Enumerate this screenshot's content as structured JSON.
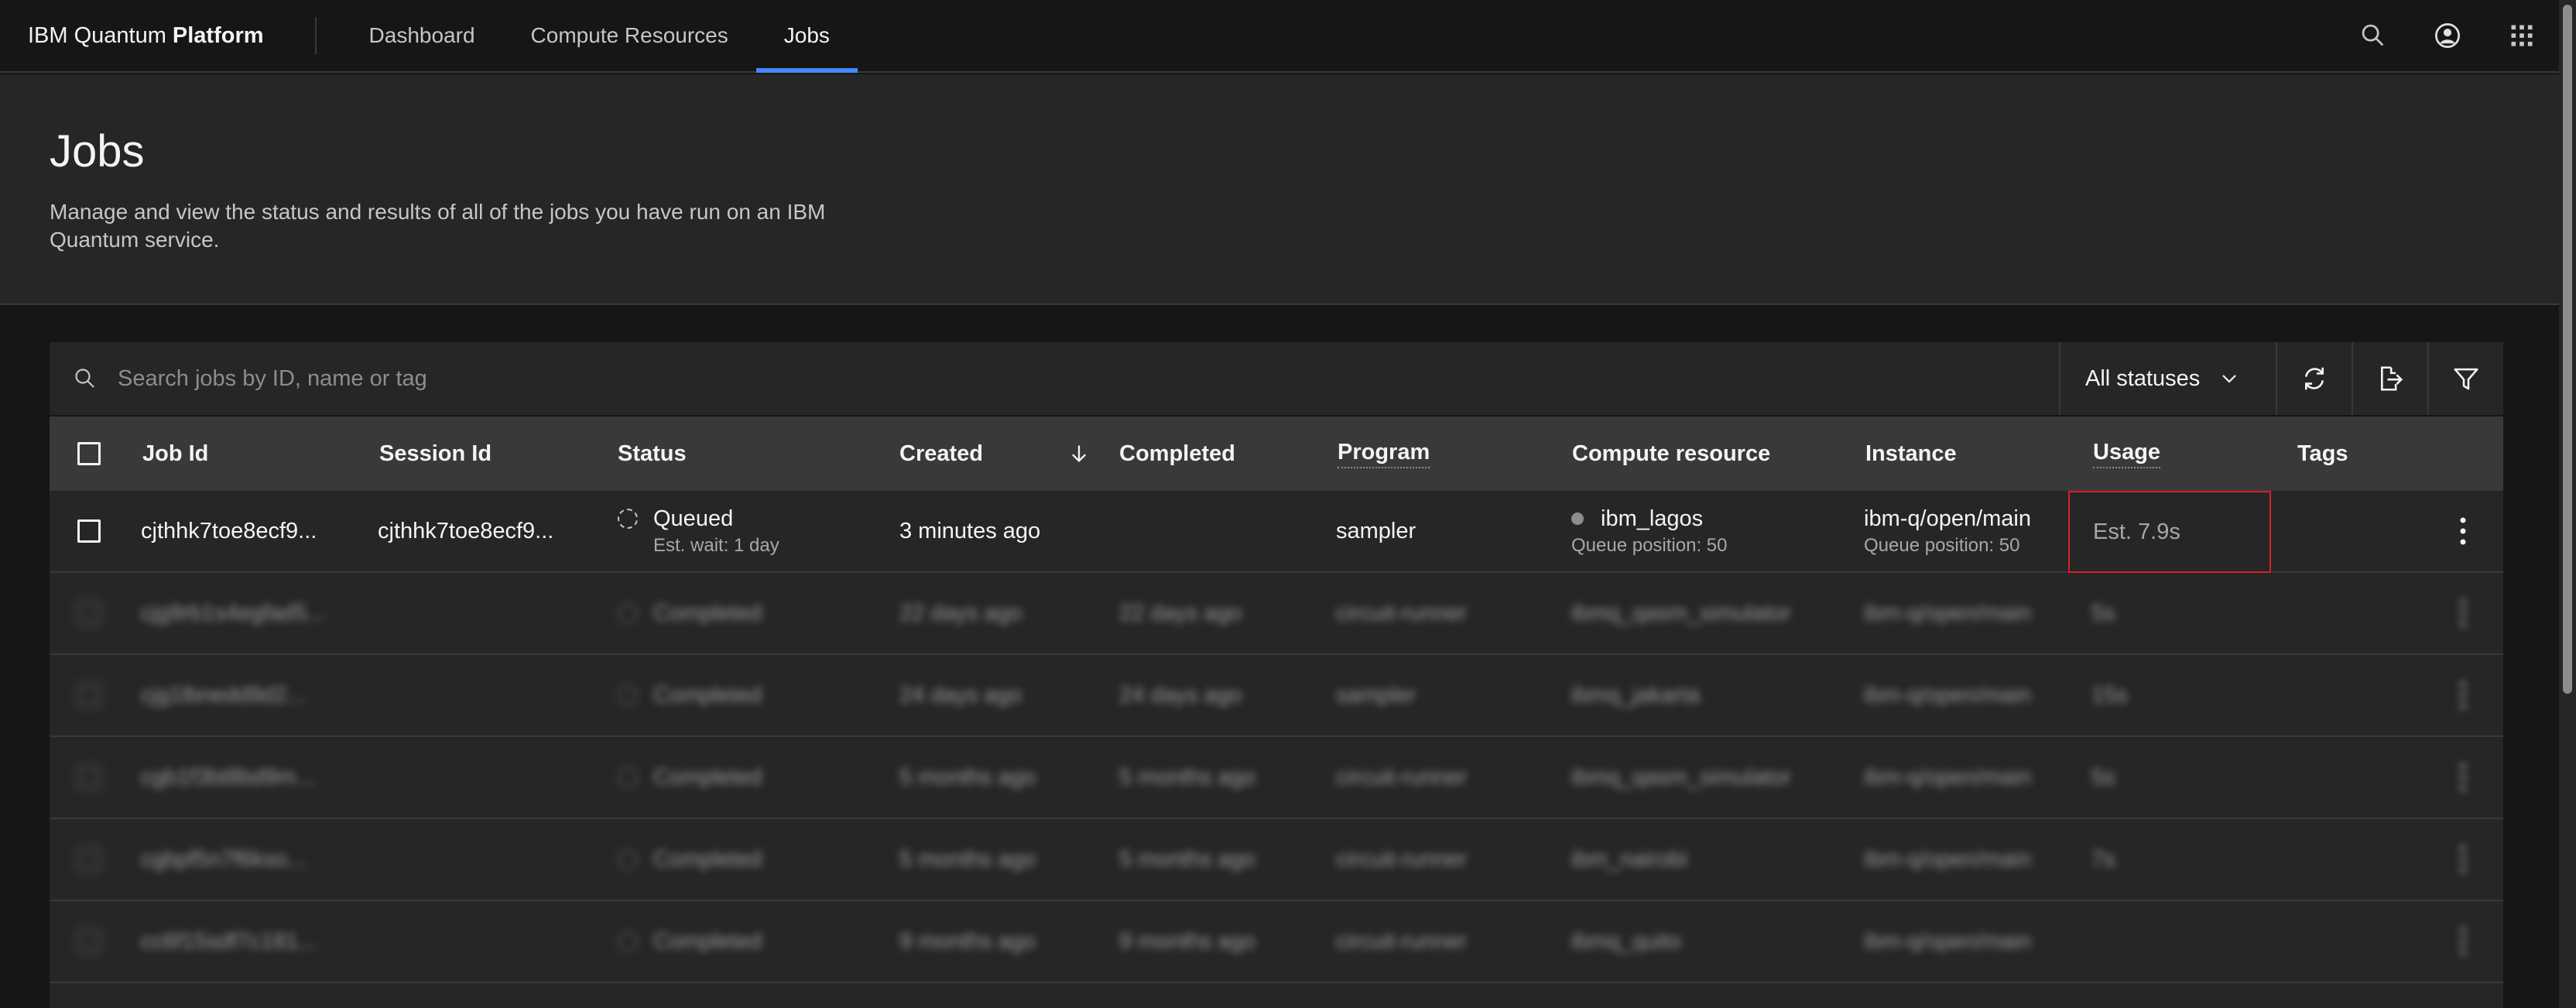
{
  "header": {
    "brand_prefix": "IBM Quantum",
    "brand_bold": "Platform",
    "nav": [
      {
        "label": "Dashboard",
        "active": false
      },
      {
        "label": "Compute Resources",
        "active": false
      },
      {
        "label": "Jobs",
        "active": true
      }
    ],
    "icons": [
      "search-icon",
      "user-avatar-icon",
      "app-switcher-icon"
    ]
  },
  "page": {
    "title": "Jobs",
    "description": "Manage and view the status and results of all of the jobs you have run on an IBM Quantum service."
  },
  "toolbar": {
    "search_placeholder": "Search jobs by ID, name or tag",
    "status_filter": "All statuses",
    "icons": [
      "refresh-icon",
      "export-icon",
      "filter-icon"
    ]
  },
  "table": {
    "columns": {
      "job_id": "Job Id",
      "session_id": "Session Id",
      "status": "Status",
      "created": "Created",
      "completed": "Completed",
      "program": "Program",
      "compute_resource": "Compute resource",
      "instance": "Instance",
      "usage": "Usage",
      "tags": "Tags"
    },
    "rows": [
      {
        "job_id": "cjthhk7toe8ecf9...",
        "session_id": "cjthhk7toe8ecf9...",
        "status": "Queued",
        "status_sub": "Est. wait: 1 day",
        "created": "3 minutes ago",
        "completed": "",
        "program": "sampler",
        "resource": "ibm_lagos",
        "resource_sub": "Queue position: 50",
        "instance": "ibm-q/open/main",
        "instance_sub": "Queue position: 50",
        "usage": "Est. 7.9s",
        "tags": ""
      },
      {
        "job_id": "cjg9rb1s4egfad5...",
        "session_id": "",
        "status": "Completed",
        "created": "22 days ago",
        "completed": "22 days ago",
        "program": "circuit-runner",
        "resource": "ibmq_qasm_simulator",
        "instance": "ibm-q/open/main",
        "usage": "5s"
      },
      {
        "job_id": "cjg1lbnedd9d2...",
        "session_id": "",
        "status": "Completed",
        "created": "24 days ago",
        "completed": "24 days ago",
        "program": "sampler",
        "resource": "ibmq_jakarta",
        "instance": "ibm-q/open/main",
        "usage": "15s"
      },
      {
        "job_id": "cgb1f3bt8bd9m...",
        "session_id": "",
        "status": "Completed",
        "created": "5 months ago",
        "completed": "5 months ago",
        "program": "circuit-runner",
        "resource": "ibmq_qasm_simulator",
        "instance": "ibm-q/open/main",
        "usage": "5s"
      },
      {
        "job_id": "cgbpf5n7f6kso...",
        "session_id": "",
        "status": "Completed",
        "created": "5 months ago",
        "completed": "5 months ago",
        "program": "circuit-runner",
        "resource": "ibm_nairobi",
        "instance": "ibm-q/open/main",
        "usage": "7s"
      },
      {
        "job_id": "cc6f15sdf7c181...",
        "session_id": "",
        "status": "Completed",
        "created": "9 months ago",
        "completed": "9 months ago",
        "program": "circuit-runner",
        "resource": "ibmq_quito",
        "instance": "ibm-q/open/main",
        "usage": ""
      }
    ]
  },
  "colors": {
    "accent": "#4589ff",
    "highlight_border": "#da1e28",
    "background": "#161616",
    "panel": "#262626",
    "table_header": "#393939"
  }
}
